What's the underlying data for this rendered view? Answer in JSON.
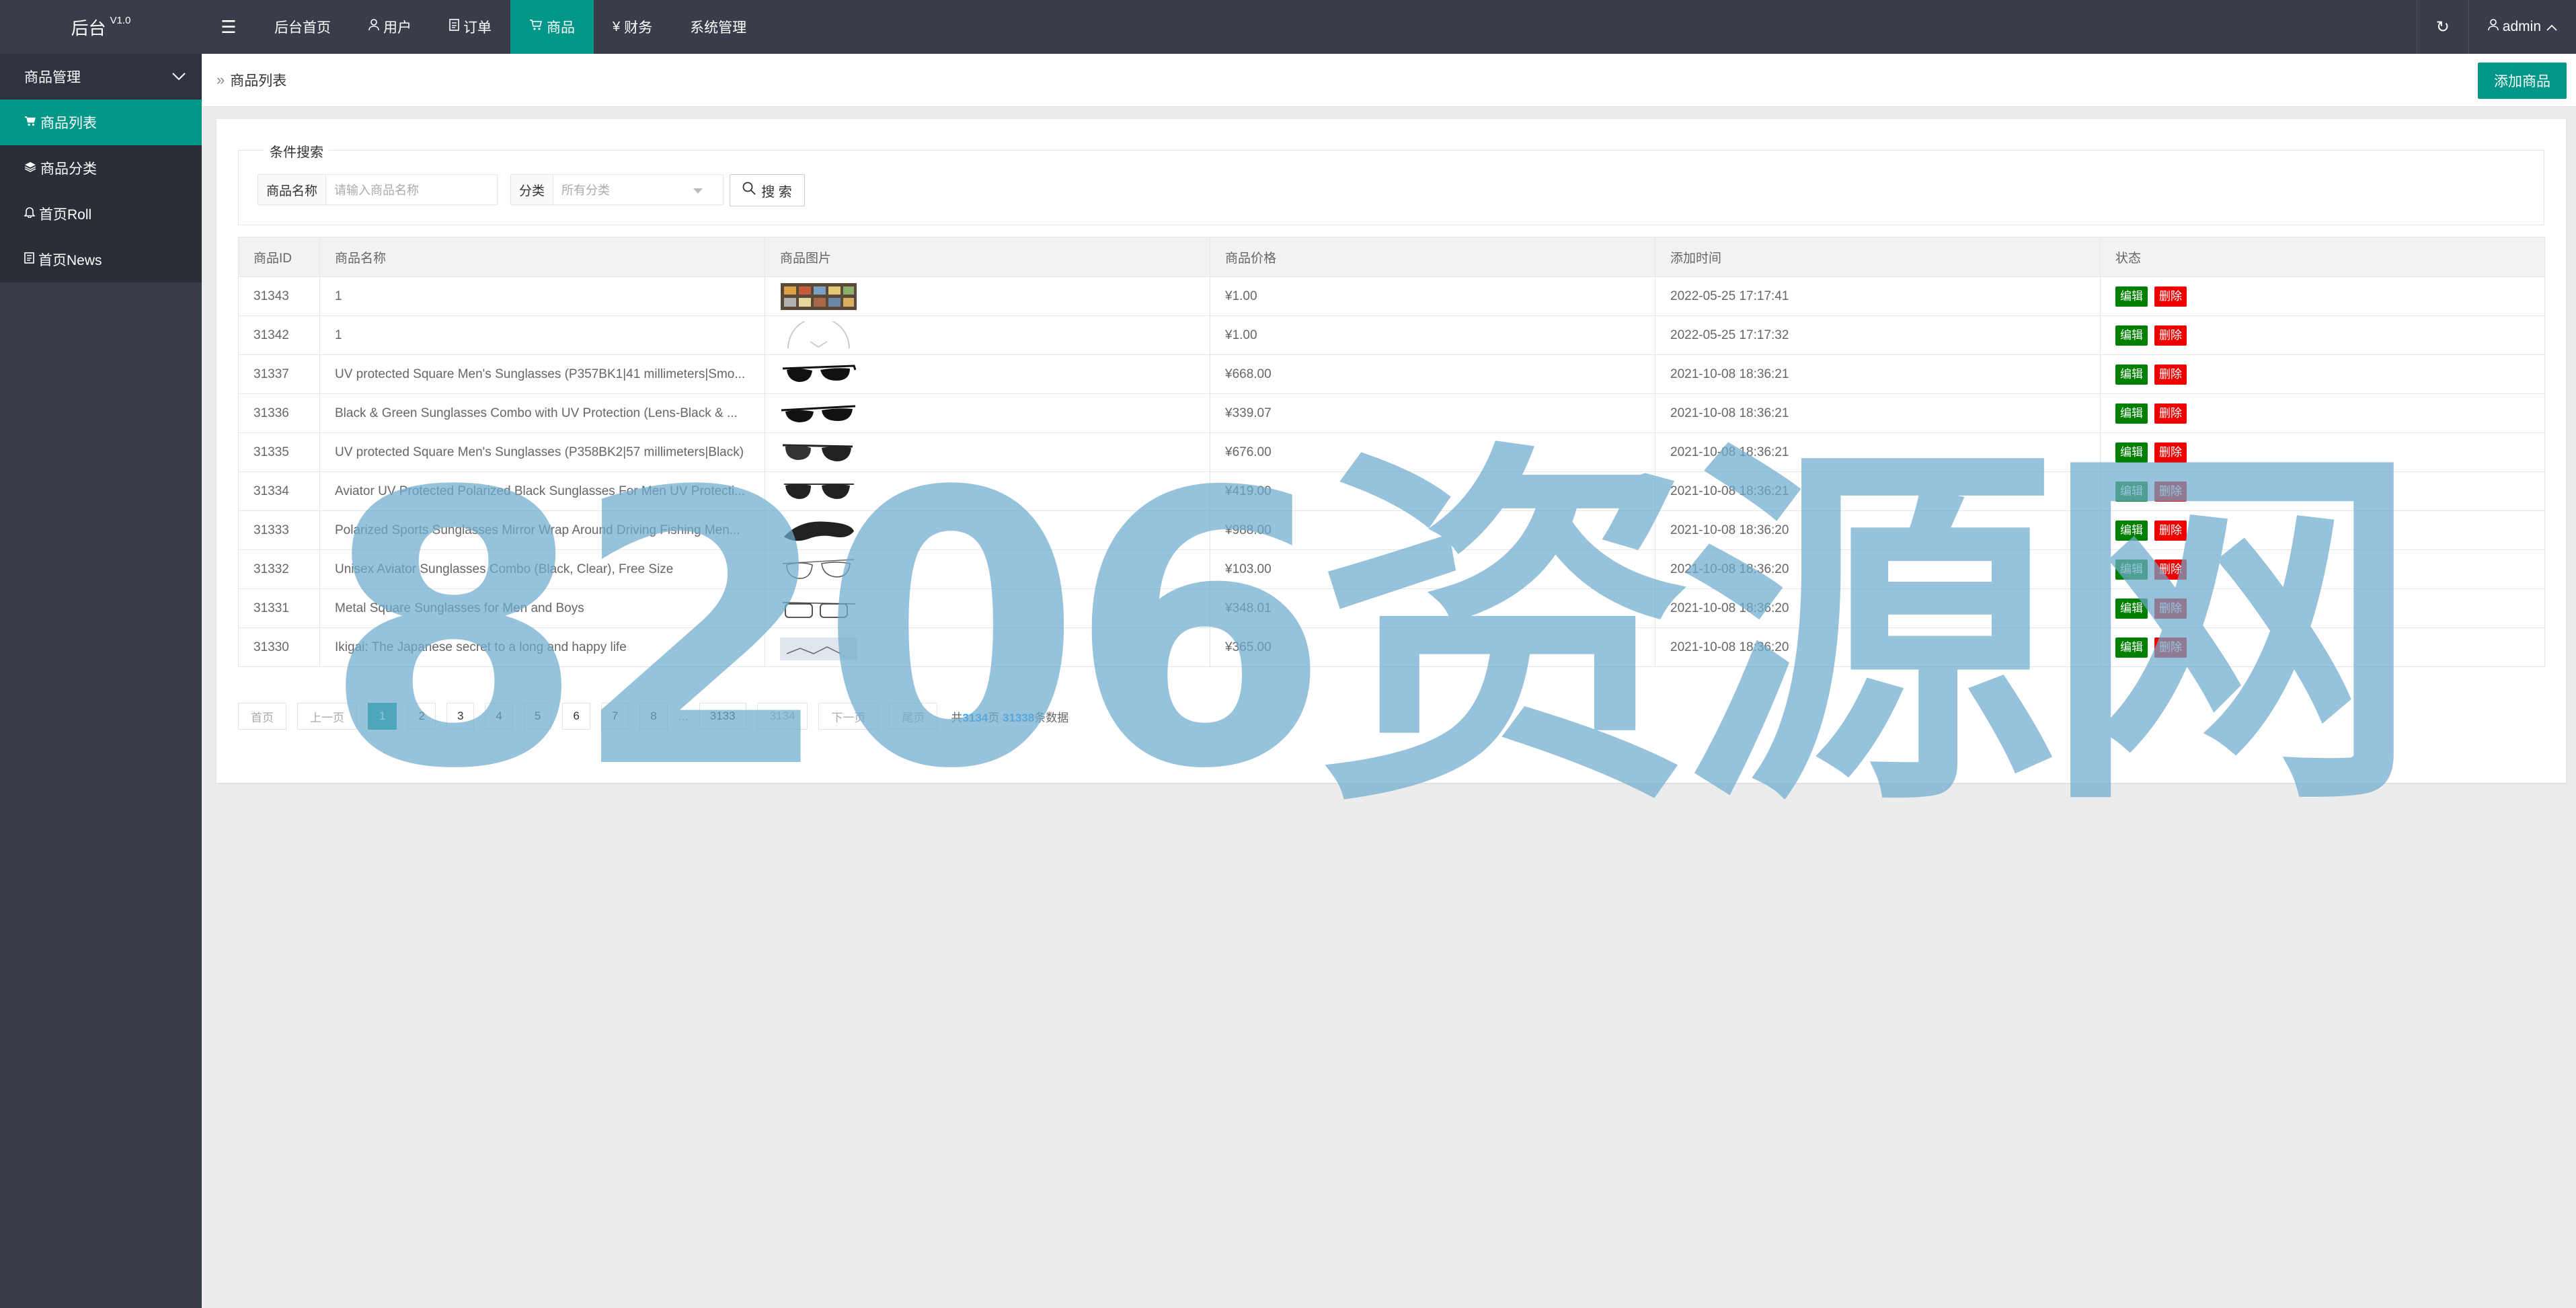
{
  "header": {
    "logo": "后台",
    "version": "V1.0",
    "menu_icon": "menu-icon",
    "nav": [
      {
        "label": "后台首页",
        "icon": ""
      },
      {
        "label": "用户",
        "icon": "user-icon"
      },
      {
        "label": "订单",
        "icon": "file-icon"
      },
      {
        "label": "商品",
        "icon": "cart-icon"
      },
      {
        "label": "财务",
        "icon": "yen-icon"
      },
      {
        "label": "系统管理",
        "icon": ""
      }
    ],
    "active_nav": "商品",
    "refresh_icon": "refresh-icon",
    "user": "admin"
  },
  "sidebar": {
    "group": "商品管理",
    "items": [
      {
        "label": "商品列表",
        "icon": "cart-icon"
      },
      {
        "label": "商品分类",
        "icon": "layers-icon"
      },
      {
        "label": "首页Roll",
        "icon": "bell-icon"
      },
      {
        "label": "首页News",
        "icon": "doc-icon"
      }
    ],
    "active": "商品列表"
  },
  "breadcrumb": {
    "current": "商品列表"
  },
  "add_button": "添加商品",
  "search": {
    "legend": "条件搜索",
    "name_label": "商品名称",
    "name_placeholder": "请输入商品名称",
    "category_label": "分类",
    "category_value": "所有分类",
    "button": "搜 索"
  },
  "table": {
    "columns": [
      "商品ID",
      "商品名称",
      "商品图片",
      "商品价格",
      "添加时间",
      "状态"
    ],
    "edit_label": "编辑",
    "delete_label": "删除",
    "rows": [
      {
        "id": "31343",
        "name": "1",
        "price": "¥1.00",
        "time": "2022-05-25 17:17:41"
      },
      {
        "id": "31342",
        "name": "1",
        "price": "¥1.00",
        "time": "2022-05-25 17:17:32"
      },
      {
        "id": "31337",
        "name": "UV protected Square Men's Sunglasses (P357BK1|41 millimeters|Smo...",
        "price": "¥668.00",
        "time": "2021-10-08 18:36:21"
      },
      {
        "id": "31336",
        "name": "Black & Green Sunglasses Combo with UV Protection (Lens-Black & ...",
        "price": "¥339.07",
        "time": "2021-10-08 18:36:21"
      },
      {
        "id": "31335",
        "name": "UV protected Square Men's Sunglasses (P358BK2|57 millimeters|Black)",
        "price": "¥676.00",
        "time": "2021-10-08 18:36:21"
      },
      {
        "id": "31334",
        "name": "Aviator UV Protected Polarized Black Sunglasses For Men UV Protecti...",
        "price": "¥419.00",
        "time": "2021-10-08 18:36:21"
      },
      {
        "id": "31333",
        "name": "Polarized Sports Sunglasses Mirror Wrap Around Driving Fishing Men...",
        "price": "¥988.00",
        "time": "2021-10-08 18:36:20"
      },
      {
        "id": "31332",
        "name": "Unisex Aviator Sunglasses Combo (Black, Clear), Free Size",
        "price": "¥103.00",
        "time": "2021-10-08 18:36:20"
      },
      {
        "id": "31331",
        "name": "Metal Square Sunglasses for Men and Boys",
        "price": "¥348.01",
        "time": "2021-10-08 18:36:20"
      },
      {
        "id": "31330",
        "name": "Ikigai: The Japanese secret to a long and happy life",
        "price": "¥365.00",
        "time": "2021-10-08 18:36:20"
      }
    ]
  },
  "pager": {
    "first": "首页",
    "prev": "上一页",
    "pages": [
      "1",
      "2",
      "3",
      "4",
      "5",
      "6",
      "7",
      "8"
    ],
    "current": "1",
    "ellipsis": "...",
    "tail": [
      "3133",
      "3134"
    ],
    "next": "下一页",
    "last": "尾页",
    "summary_prefix": "共",
    "total_pages": "3134",
    "summary_mid": "页 ",
    "total_records": "31338",
    "summary_suffix": "条数据"
  },
  "watermark": "8206资源网"
}
